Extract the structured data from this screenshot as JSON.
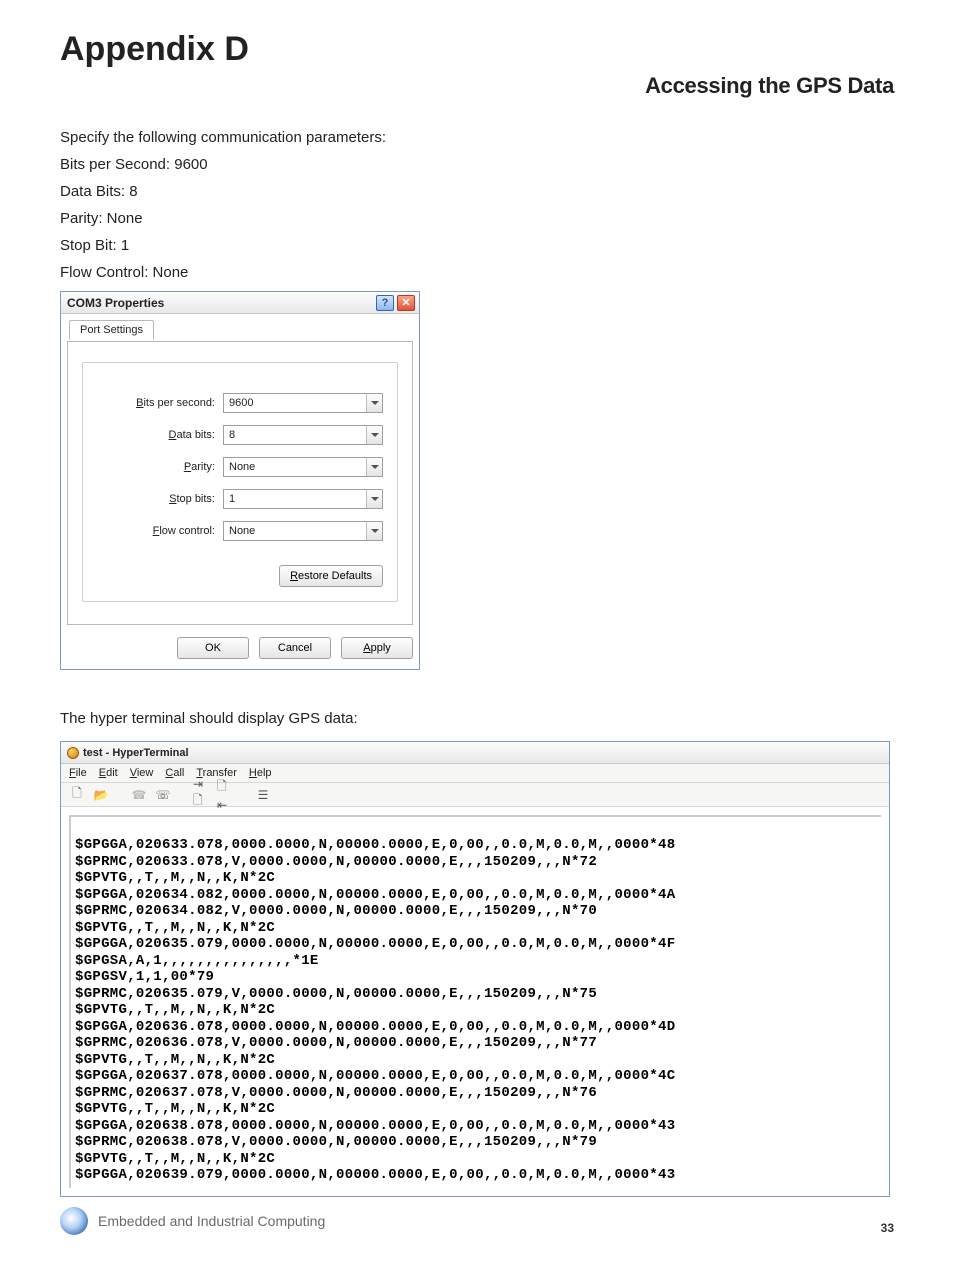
{
  "heading": "Appendix D",
  "subheading": "Accessing the GPS Data",
  "intro": "Specify the following communication parameters:",
  "params": [
    "Bits per Second: 9600",
    "Data Bits: 8",
    "Parity: None",
    "Stop Bit: 1",
    "Flow Control: None"
  ],
  "dialog": {
    "title": "COM3 Properties",
    "tab": "Port Settings",
    "fields": {
      "bits_per_second": {
        "label": "Bits per second:",
        "value": "9600"
      },
      "data_bits": {
        "label": "Data bits:",
        "value": "8"
      },
      "parity": {
        "label": "Parity:",
        "value": "None"
      },
      "stop_bits": {
        "label": "Stop bits:",
        "value": "1"
      },
      "flow_control": {
        "label": "Flow control:",
        "value": "None"
      }
    },
    "restore": "Restore Defaults",
    "ok": "OK",
    "cancel": "Cancel",
    "apply": "Apply"
  },
  "afterDialog": "The hyper terminal should display GPS data:",
  "ht": {
    "title": "test - HyperTerminal",
    "menus": [
      "File",
      "Edit",
      "View",
      "Call",
      "Transfer",
      "Help"
    ],
    "output": "$GPGGA,020633.078,0000.0000,N,00000.0000,E,0,00,,0.0,M,0.0,M,,0000*48\n$GPRMC,020633.078,V,0000.0000,N,00000.0000,E,,,150209,,,N*72\n$GPVTG,,T,,M,,N,,K,N*2C\n$GPGGA,020634.082,0000.0000,N,00000.0000,E,0,00,,0.0,M,0.0,M,,0000*4A\n$GPRMC,020634.082,V,0000.0000,N,00000.0000,E,,,150209,,,N*70\n$GPVTG,,T,,M,,N,,K,N*2C\n$GPGGA,020635.079,0000.0000,N,00000.0000,E,0,00,,0.0,M,0.0,M,,0000*4F\n$GPGSA,A,1,,,,,,,,,,,,,,,*1E\n$GPGSV,1,1,00*79\n$GPRMC,020635.079,V,0000.0000,N,00000.0000,E,,,150209,,,N*75\n$GPVTG,,T,,M,,N,,K,N*2C\n$GPGGA,020636.078,0000.0000,N,00000.0000,E,0,00,,0.0,M,0.0,M,,0000*4D\n$GPRMC,020636.078,V,0000.0000,N,00000.0000,E,,,150209,,,N*77\n$GPVTG,,T,,M,,N,,K,N*2C\n$GPGGA,020637.078,0000.0000,N,00000.0000,E,0,00,,0.0,M,0.0,M,,0000*4C\n$GPRMC,020637.078,V,0000.0000,N,00000.0000,E,,,150209,,,N*76\n$GPVTG,,T,,M,,N,,K,N*2C\n$GPGGA,020638.078,0000.0000,N,00000.0000,E,0,00,,0.0,M,0.0,M,,0000*43\n$GPRMC,020638.078,V,0000.0000,N,00000.0000,E,,,150209,,,N*79\n$GPVTG,,T,,M,,N,,K,N*2C\n$GPGGA,020639.079,0000.0000,N,00000.0000,E,0,00,,0.0,M,0.0,M,,0000*43"
  },
  "footer": "Embedded and Industrial Computing",
  "pageNumber": "33"
}
